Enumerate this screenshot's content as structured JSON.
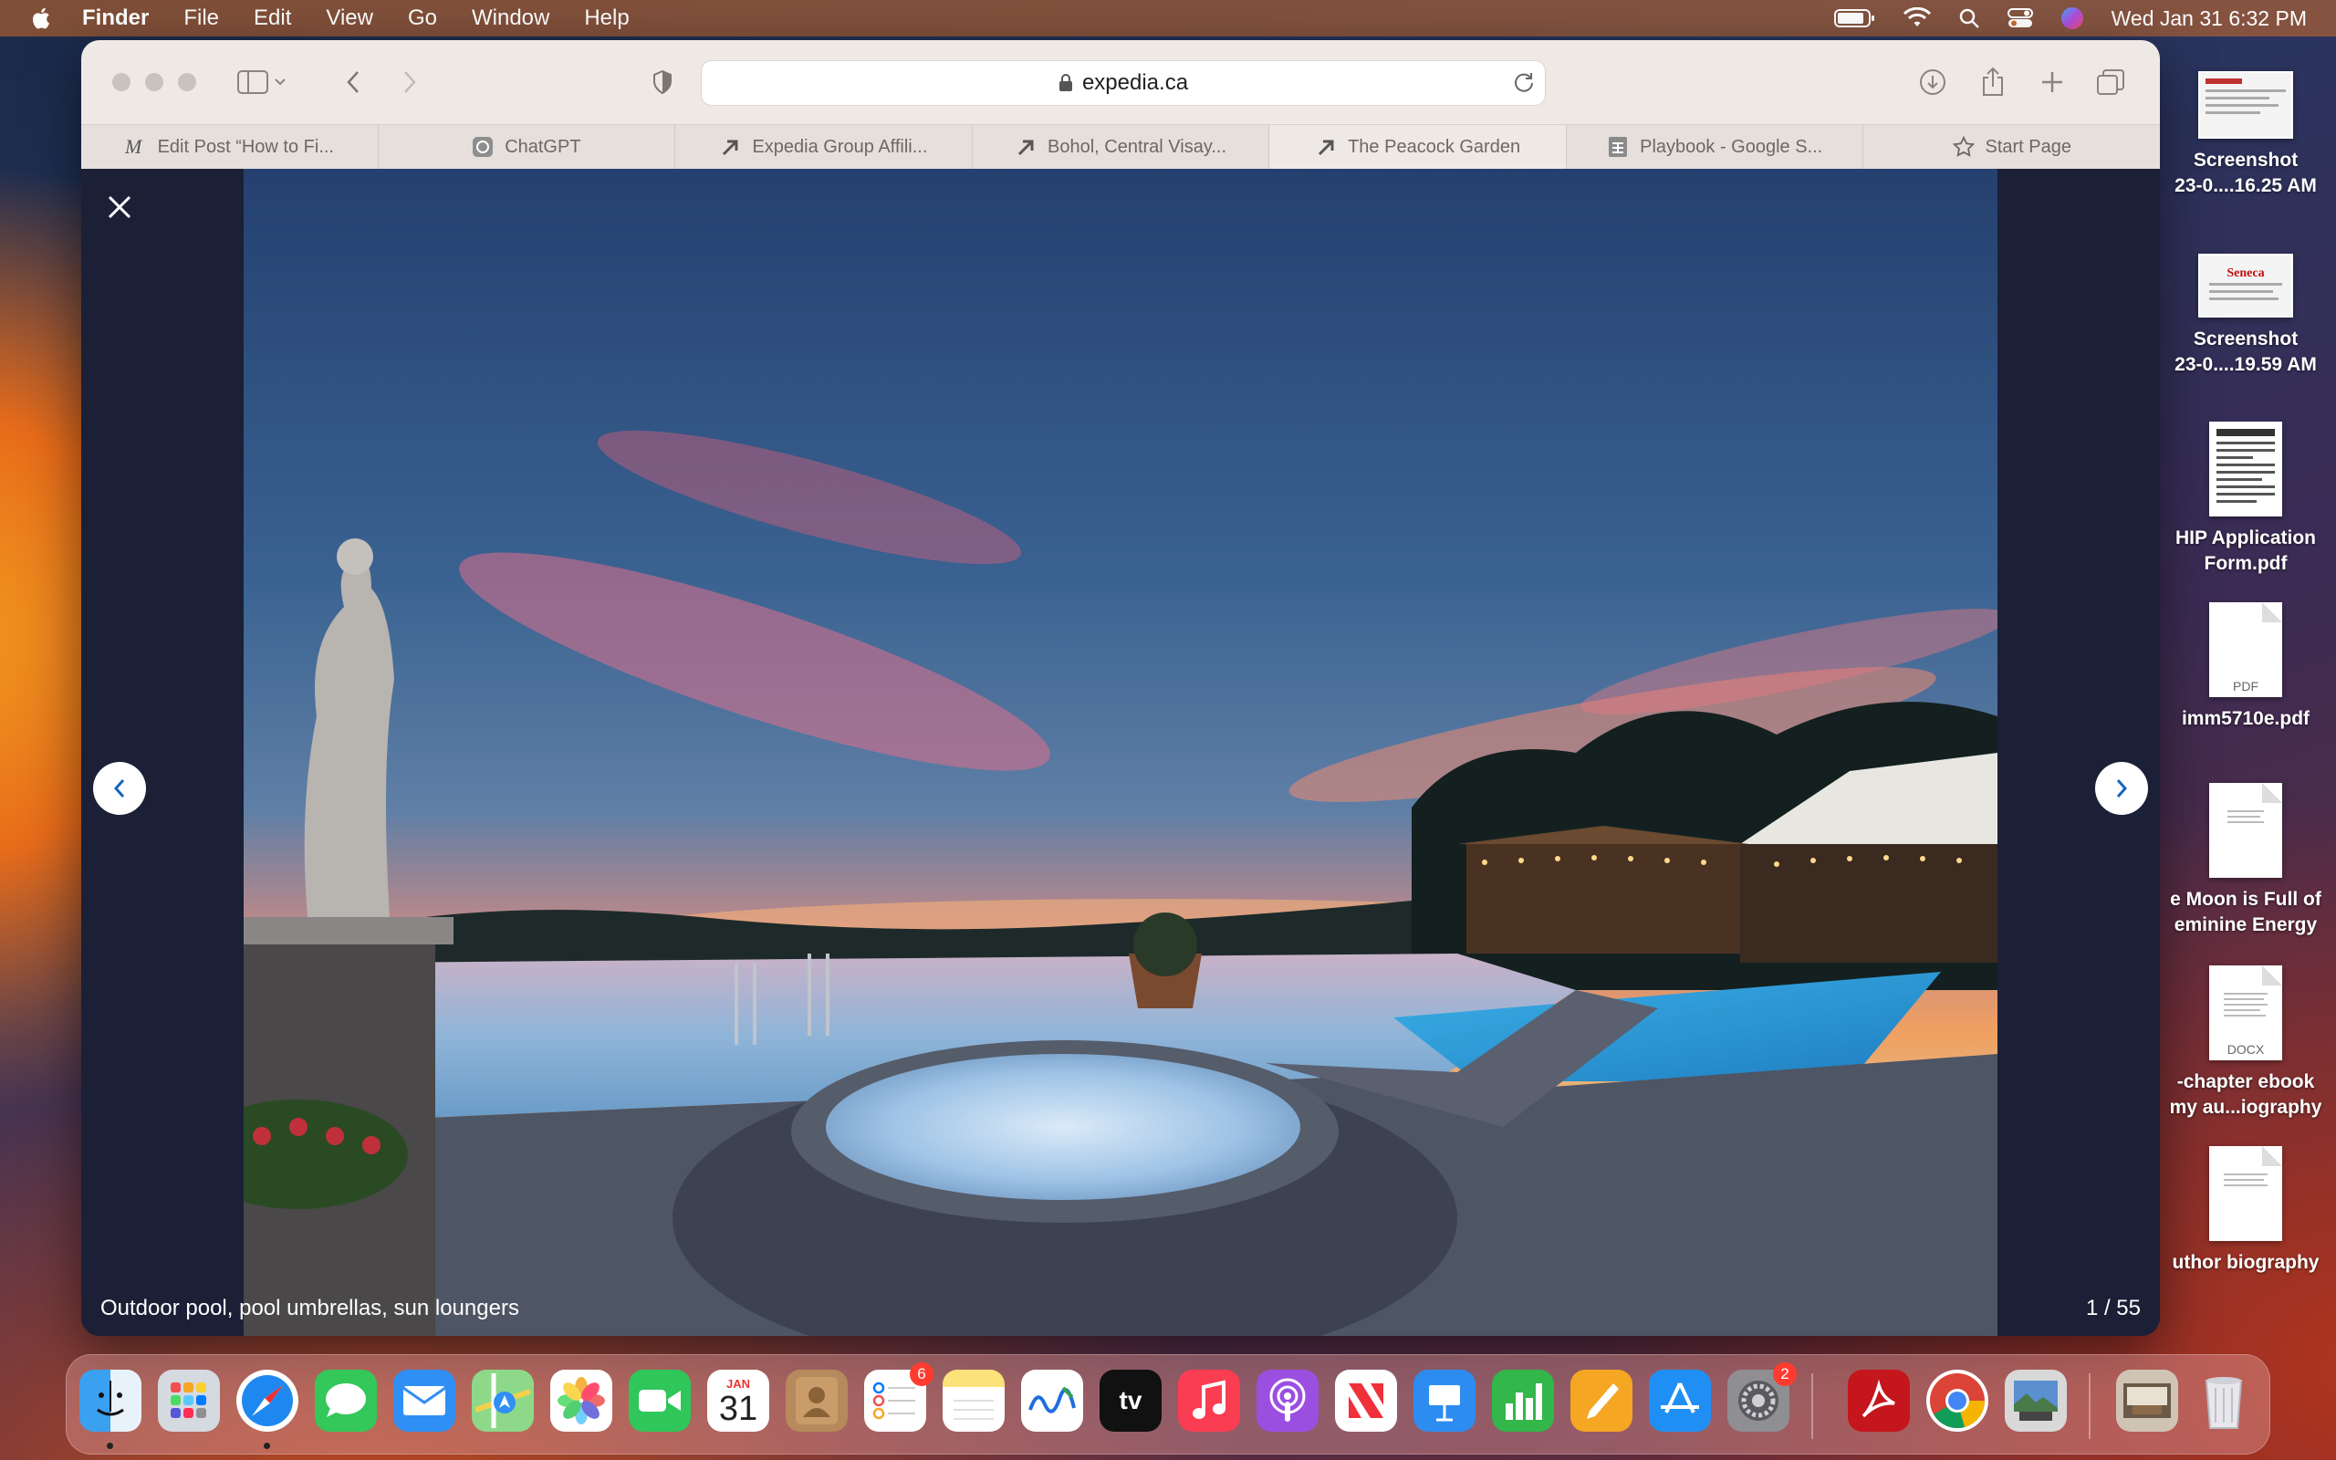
{
  "menubar": {
    "app_name": "Finder",
    "menus": [
      "File",
      "Edit",
      "View",
      "Go",
      "Window",
      "Help"
    ],
    "clock": "Wed Jan 31  6:32 PM",
    "status_icons": [
      "battery-icon",
      "wifi-icon",
      "spotlight-icon",
      "control-center-icon",
      "siri-icon"
    ]
  },
  "browser": {
    "url": "expedia.ca",
    "tabs": [
      {
        "label": "Edit Post “How to Fi...",
        "icon": "medium-icon"
      },
      {
        "label": "ChatGPT",
        "icon": "chatgpt-icon"
      },
      {
        "label": "Expedia Group Affili...",
        "icon": "expedia-icon"
      },
      {
        "label": "Bohol, Central Visay...",
        "icon": "expedia-icon"
      },
      {
        "label": "The Peacock Garden",
        "icon": "expedia-icon",
        "active": true
      },
      {
        "label": "Playbook - Google S...",
        "icon": "sheets-icon"
      },
      {
        "label": "Start Page",
        "icon": "star-icon"
      }
    ]
  },
  "gallery": {
    "caption": "Outdoor pool, pool umbrellas, sun loungers",
    "counter": "1 / 55",
    "current": 1,
    "total": 55
  },
  "desktop": {
    "items": [
      {
        "line1": "Screenshot",
        "line2": "23-0....16.25 AM",
        "kind": "screenshot"
      },
      {
        "line1": "Screenshot",
        "line2": "23-0....19.59 AM",
        "kind": "screenshot",
        "thumb_text": "Seneca"
      },
      {
        "line1": "HIP Application",
        "line2": "Form.pdf",
        "kind": "document"
      },
      {
        "line1": "imm5710e.pdf",
        "line2": "",
        "kind": "pdf",
        "thumb_text": "PDF"
      },
      {
        "line1": "e Moon is Full of",
        "line2": "eminine Energy",
        "kind": "document"
      },
      {
        "line1": "-chapter ebook",
        "line2": "my au...iography",
        "kind": "docx",
        "thumb_text": "DOCX"
      },
      {
        "line1": "uthor biography",
        "line2": "",
        "kind": "document"
      }
    ]
  },
  "dock": {
    "apps": [
      {
        "name": "Finder",
        "icon": "finder-icon",
        "color": "#3da8f5",
        "running": true
      },
      {
        "name": "Launchpad",
        "icon": "launchpad-icon",
        "color": "#d0d4dc"
      },
      {
        "name": "Safari",
        "icon": "safari-icon",
        "color": "#1e88f0",
        "running": true
      },
      {
        "name": "Messages",
        "icon": "messages-icon",
        "color": "#34c759"
      },
      {
        "name": "Mail",
        "icon": "mail-icon",
        "color": "#2f8ff5"
      },
      {
        "name": "Maps",
        "icon": "maps-icon",
        "color": "#6ccf6a"
      },
      {
        "name": "Photos",
        "icon": "photos-icon",
        "color": "#ffffff"
      },
      {
        "name": "FaceTime",
        "icon": "facetime-icon",
        "color": "#2fc65a"
      },
      {
        "name": "Calendar",
        "icon": "calendar-icon",
        "color": "#ffffff",
        "month": "JAN",
        "day": "31"
      },
      {
        "name": "Contacts",
        "icon": "contacts-icon",
        "color": "#b68a5c"
      },
      {
        "name": "Reminders",
        "icon": "reminders-icon",
        "color": "#ffffff",
        "badge": "6"
      },
      {
        "name": "Notes",
        "icon": "notes-icon",
        "color": "#fce27a"
      },
      {
        "name": "Freeform",
        "icon": "freeform-icon",
        "color": "#ffffff"
      },
      {
        "name": "TV",
        "icon": "tv-icon",
        "color": "#111111",
        "label": "tv"
      },
      {
        "name": "Music",
        "icon": "music-icon",
        "color": "#fa3d52"
      },
      {
        "name": "Podcasts",
        "icon": "podcasts-icon",
        "color": "#9b4fe0"
      },
      {
        "name": "News",
        "icon": "news-icon",
        "color": "#ffffff"
      },
      {
        "name": "Keynote",
        "icon": "keynote-icon",
        "color": "#2d8cf0"
      },
      {
        "name": "Numbers",
        "icon": "numbers-icon",
        "color": "#33b64a"
      },
      {
        "name": "Pages",
        "icon": "pages-icon",
        "color": "#f5a623"
      },
      {
        "name": "App Store",
        "icon": "app-store-icon",
        "color": "#1f8ff5"
      },
      {
        "name": "System Settings",
        "icon": "settings-icon",
        "color": "#8e8e93",
        "badge": "2"
      },
      {
        "name": "Acrobat",
        "icon": "acrobat-icon",
        "color": "#c4161c"
      },
      {
        "name": "Chrome",
        "icon": "chrome-icon",
        "color": "#ffffff"
      },
      {
        "name": "Preview",
        "icon": "preview-icon",
        "color": "#d8d8d8"
      },
      {
        "name": "Downloads stack",
        "icon": "image-stack-icon",
        "color": "#cfc4b4"
      },
      {
        "name": "Trash",
        "icon": "trash-icon",
        "color": "#e8e8e8"
      }
    ]
  }
}
